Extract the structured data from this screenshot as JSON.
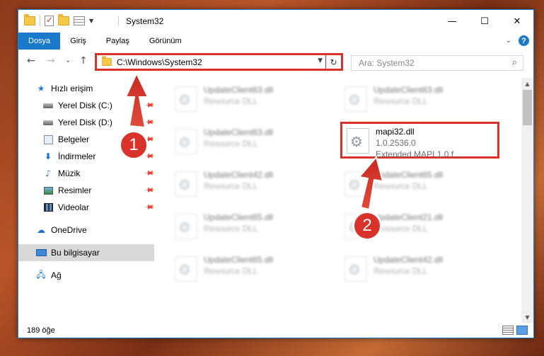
{
  "window": {
    "title": "System32",
    "controls": {
      "minimize": "—",
      "maximize": "☐",
      "close": "✕"
    }
  },
  "ribbon": {
    "tabs": [
      {
        "label": "Dosya",
        "active": true
      },
      {
        "label": "Giriş",
        "active": false
      },
      {
        "label": "Paylaş",
        "active": false
      },
      {
        "label": "Görünüm",
        "active": false
      }
    ],
    "help": "?"
  },
  "navigation": {
    "back": "←",
    "forward": "→",
    "recent": "⌄",
    "up": "↑",
    "address": "C:\\Windows\\System32",
    "search_placeholder": "Ara: System32"
  },
  "sidebar": {
    "items": [
      {
        "label": "Hızlı erişim",
        "icon": "star-icon",
        "indent": false,
        "pinned": false
      },
      {
        "label": "Yerel Disk (C:)",
        "icon": "drive-icon",
        "indent": true,
        "pinned": true
      },
      {
        "label": "Yerel Disk (D:)",
        "icon": "drive-icon",
        "indent": true,
        "pinned": true
      },
      {
        "label": "Belgeler",
        "icon": "documents-icon",
        "indent": true,
        "pinned": true
      },
      {
        "label": "İndirmeler",
        "icon": "downloads-icon",
        "indent": true,
        "pinned": true
      },
      {
        "label": "Müzik",
        "icon": "music-icon",
        "indent": true,
        "pinned": true
      },
      {
        "label": "Resimler",
        "icon": "pictures-icon",
        "indent": true,
        "pinned": true
      },
      {
        "label": "Videolar",
        "icon": "videos-icon",
        "indent": true,
        "pinned": true
      },
      {
        "label": "OneDrive",
        "icon": "onedrive-icon",
        "indent": false,
        "pinned": false
      },
      {
        "label": "Bu bilgisayar",
        "icon": "computer-icon",
        "indent": false,
        "pinned": false,
        "selected": true
      },
      {
        "label": "Ağ",
        "icon": "network-icon",
        "indent": false,
        "pinned": false
      }
    ]
  },
  "files": [
    {
      "name": "UpdateClient63.dll",
      "desc": "Resource DLL",
      "blurred": true
    },
    {
      "name": "UpdateClient63.dll",
      "desc": "Resource DLL",
      "blurred": true
    },
    {
      "name": "UpdateClient63.dll",
      "desc": "Resource DLL",
      "blurred": true
    },
    {
      "name": "mapi32.dll",
      "version": "1.0.2536.0",
      "desc": "Extended MAPI 1.0 f...",
      "blurred": false,
      "highlighted": true
    },
    {
      "name": "UpdateClient42.dll",
      "desc": "Resource DLL",
      "blurred": true
    },
    {
      "name": "UpdateClient65.dll",
      "desc": "Resource DLL",
      "blurred": true
    },
    {
      "name": "UpdateClient65.dll",
      "desc": "Resource DLL",
      "blurred": true
    },
    {
      "name": "UpdateClient21.dll",
      "desc": "Resource DLL",
      "blurred": true
    },
    {
      "name": "UpdateClient65.dll",
      "desc": "Resource DLL",
      "blurred": true
    },
    {
      "name": "UpdateClient42.dll",
      "desc": "Resource DLL",
      "blurred": true
    }
  ],
  "status": {
    "item_count": "189 öğe"
  },
  "annotations": {
    "badge1": "1",
    "badge2": "2",
    "accent": "#d9322a"
  }
}
